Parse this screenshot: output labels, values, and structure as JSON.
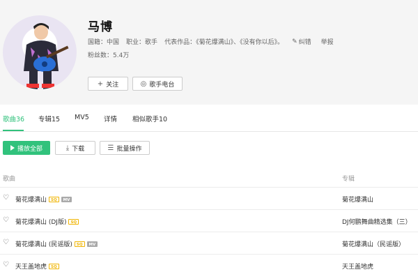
{
  "artist": {
    "name": "马博",
    "country_label": "国籍：",
    "country": "中国",
    "job_label": "职业：",
    "job": "歌手",
    "works_label": "代表作品：",
    "works": "《菊花爆满山》、《没有你以后》。",
    "correct_label": "纠错",
    "report_label": "举报",
    "fans_label": "粉丝数：",
    "fans": "5.4万"
  },
  "buttons": {
    "follow": "关注",
    "radio": "歌手电台"
  },
  "tabs": [
    {
      "label": "歌曲36",
      "active": true
    },
    {
      "label": "专辑15",
      "active": false
    },
    {
      "label": "MV5",
      "active": false
    },
    {
      "label": "详情",
      "active": false
    },
    {
      "label": "相似歌手10",
      "active": false
    }
  ],
  "actions": {
    "play_all": "播放全部",
    "download": "下载",
    "batch": "批量操作"
  },
  "table": {
    "col_song": "歌曲",
    "col_album": "专辑",
    "rows": [
      {
        "title": "菊花爆满山",
        "badges": [
          "SQ",
          "MV"
        ],
        "album": "菊花爆满山"
      },
      {
        "title": "菊花爆满山 (DJ版)",
        "badges": [
          "SQ"
        ],
        "album": "DJ何鹏舞曲精选集（三）"
      },
      {
        "title": "菊花爆满山 (民谣版)",
        "badges": [
          "SQ",
          "MV"
        ],
        "album": "菊花爆满山（民谣版）"
      },
      {
        "title": "天王盖地虎",
        "badges": [
          "SQ"
        ],
        "album": "天王盖地虎"
      }
    ]
  },
  "colors": {
    "accent": "#31c27c",
    "sq_badge": "#f0b400",
    "mv_badge": "#aaaaaa"
  },
  "icons": {
    "follow": "plus-icon",
    "radio": "radio-icon",
    "correct": "edit-icon",
    "play": "play-icon",
    "download": "download-icon",
    "batch": "list-icon",
    "like": "heart-icon"
  }
}
